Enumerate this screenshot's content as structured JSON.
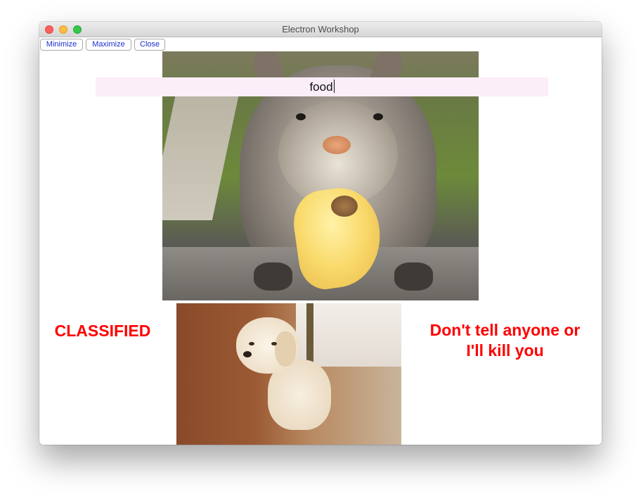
{
  "window": {
    "title": "Electron Workshop"
  },
  "toolbar": {
    "minimize_label": "Minimize",
    "maximize_label": "Maximize",
    "close_label": "Close"
  },
  "search": {
    "value": "food"
  },
  "captions": {
    "left": "CLASSIFIED",
    "right_line1": "Don't tell anyone or",
    "right_line2": "I'll kill you"
  },
  "colors": {
    "caption": "#ff0000",
    "button_text": "#1a2fd0",
    "search_background": "#fbeef8"
  }
}
